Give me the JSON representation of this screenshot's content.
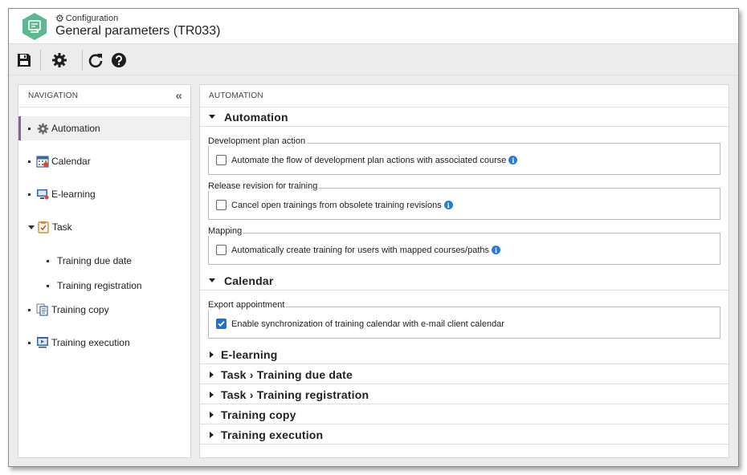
{
  "header": {
    "breadcrumb": "Configuration",
    "title": "General parameters (TR033)"
  },
  "toolbar": {
    "buttons": [
      {
        "name": "save-icon",
        "tooltip": "Save"
      },
      {
        "name": "gear-icon",
        "tooltip": "Settings"
      },
      {
        "name": "refresh-icon",
        "tooltip": "Refresh"
      },
      {
        "name": "help-icon",
        "tooltip": "Help"
      }
    ]
  },
  "navigation": {
    "title": "NAVIGATION",
    "collapse_glyph": "«",
    "items": [
      {
        "label": "Automation",
        "icon": "gear-icon"
      },
      {
        "label": "Calendar",
        "icon": "calendar-icon"
      },
      {
        "label": "E-learning",
        "icon": "monitor-icon"
      },
      {
        "label": "Task",
        "icon": "clipboard-check-icon"
      },
      {
        "label": "Training copy",
        "icon": "copy-icon"
      },
      {
        "label": "Training execution",
        "icon": "presentation-icon"
      }
    ],
    "task_children": [
      {
        "label": "Training due date"
      },
      {
        "label": "Training registration"
      }
    ]
  },
  "main": {
    "title": "AUTOMATION",
    "sections": {
      "automation": {
        "title": "Automation",
        "groups": [
          {
            "legend": "Development plan action",
            "option": "Automate the flow of development plan actions with associated course",
            "checked": false
          },
          {
            "legend": "Release revision for training",
            "option": "Cancel open trainings from obsolete training revisions",
            "checked": false
          },
          {
            "legend": "Mapping",
            "option": "Automatically create training for users with mapped courses/paths",
            "checked": false
          }
        ]
      },
      "calendar": {
        "title": "Calendar",
        "groups": [
          {
            "legend": "Export appointment",
            "option": "Enable synchronization of training calendar with e-mail client calendar",
            "checked": true
          }
        ]
      },
      "collapsed": [
        {
          "title": "E-learning"
        },
        {
          "title": "Task › Training due date"
        },
        {
          "title": "Task › Training registration"
        },
        {
          "title": "Training copy"
        },
        {
          "title": "Training execution"
        }
      ]
    }
  },
  "colors": {
    "accent_purple": "#8e5aa8",
    "logo_green": "#5cb891",
    "checkbox_blue": "#1a73d8",
    "info_blue": "#2a7bd4"
  }
}
